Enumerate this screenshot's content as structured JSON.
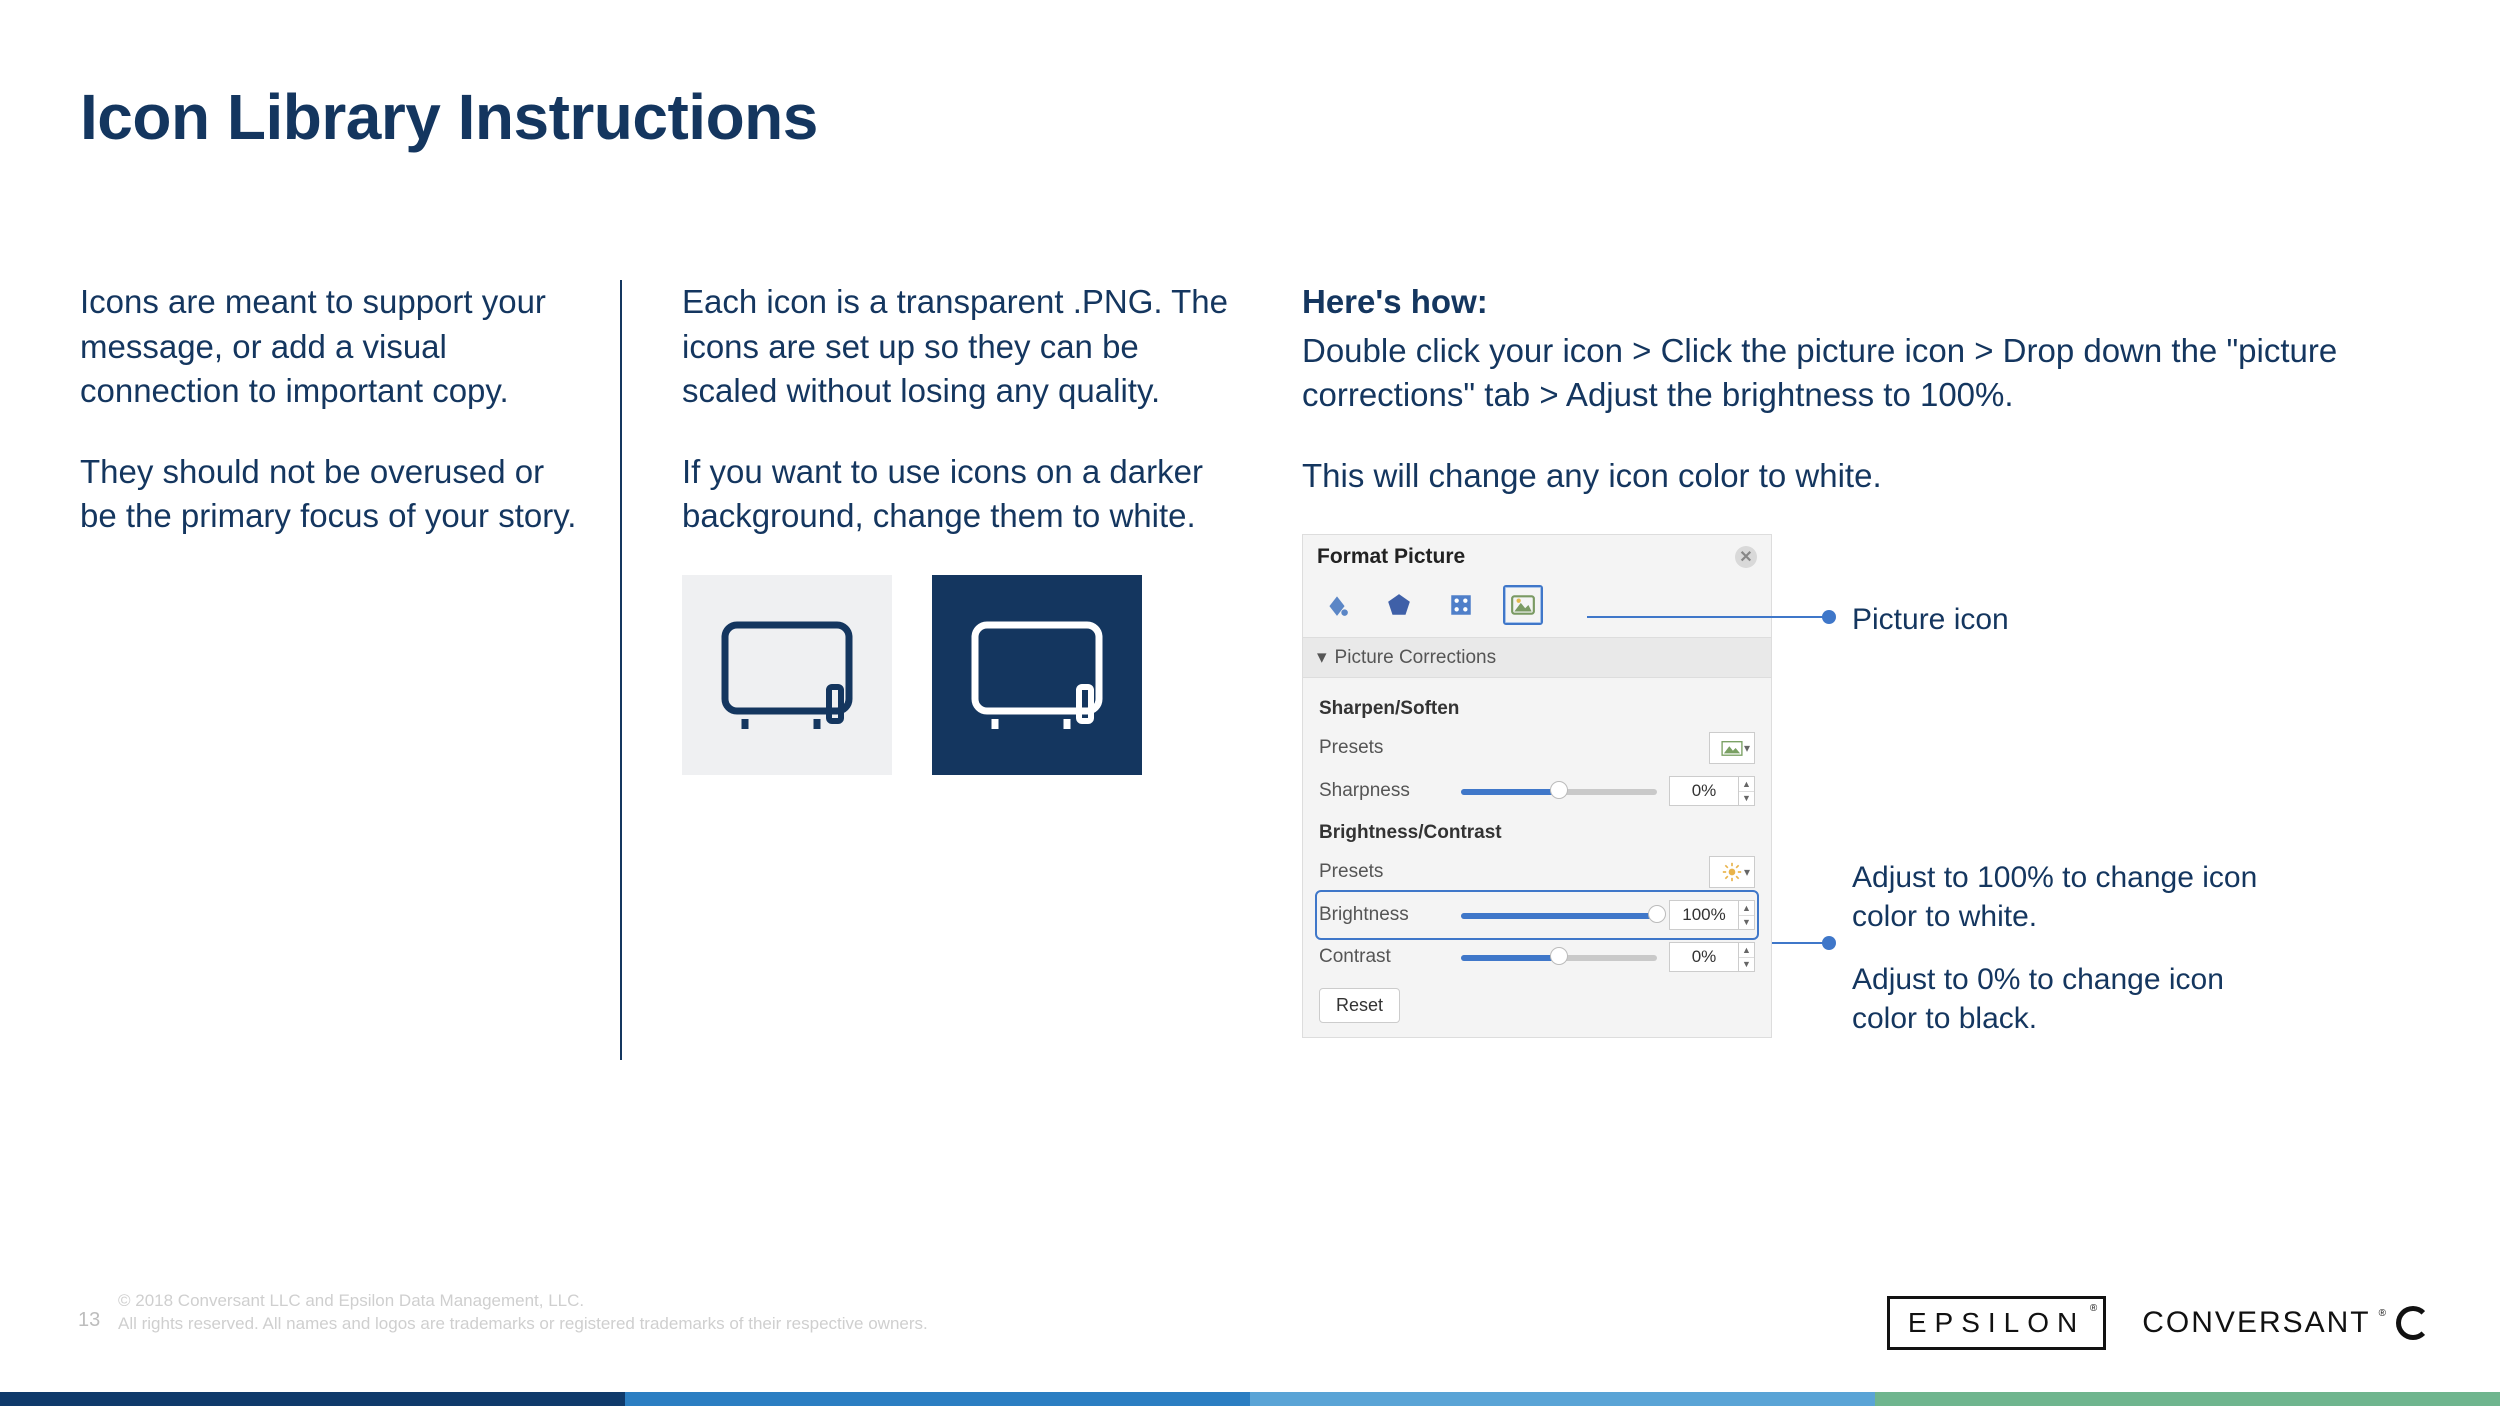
{
  "title": "Icon Library Instructions",
  "col1": {
    "p1": "Icons are meant to support your message, or add a visual connection to important copy.",
    "p2": "They should not be overused or be the primary focus of your story."
  },
  "col2": {
    "p1": "Each icon is a transparent .PNG. The icons are set up so they can be scaled without losing any quality.",
    "p2": "If you want to use icons on a darker background, change them to white."
  },
  "col3": {
    "label": "Here's how:",
    "p1": "Double click your icon > Click the picture icon > Drop down the \"picture corrections\" tab > Adjust the brightness to 100%.",
    "p2": "This will change any icon color to white."
  },
  "panel": {
    "title": "Format Picture",
    "section": "Picture Corrections",
    "sharpen_head": "Sharpen/Soften",
    "presets_label": "Presets",
    "sharpness_label": "Sharpness",
    "sharpness_value": "0%",
    "bc_head": "Brightness/Contrast",
    "brightness_label": "Brightness",
    "brightness_value": "100%",
    "contrast_label": "Contrast",
    "contrast_value": "0%",
    "reset_label": "Reset"
  },
  "callouts": {
    "picture_icon": "Picture icon",
    "adjust_100": "Adjust to 100% to change icon color to white.",
    "adjust_0": "Adjust to 0% to change icon color to black."
  },
  "footer": {
    "page": "13",
    "line1": "© 2018 Conversant LLC and Epsilon Data Management, LLC.",
    "line2": "All rights reserved. All names and logos are trademarks or registered trademarks of their respective owners."
  },
  "logos": {
    "epsilon": "EPSILON",
    "conversant": "CONVERSANT"
  }
}
